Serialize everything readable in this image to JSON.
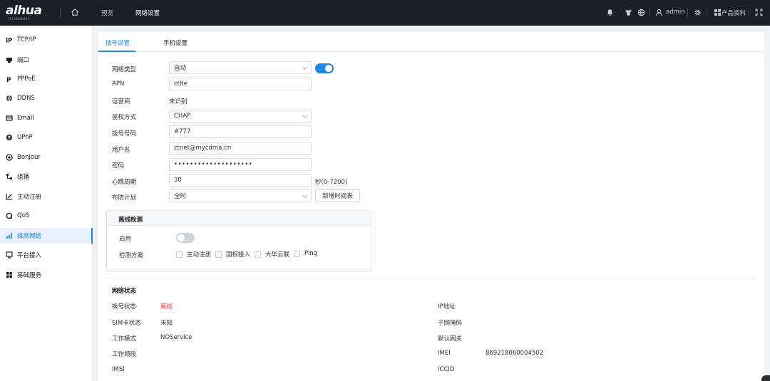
{
  "topbar": {
    "logo": "alhua",
    "logo_sub": "TECHNOLOGY",
    "nav": [
      {
        "label": "预览"
      },
      {
        "label": "网络设置"
      }
    ],
    "user": "admin",
    "docs": "产品资料"
  },
  "sidebar": {
    "items": [
      {
        "label": "TCP/IP",
        "icon": "ip-icon"
      },
      {
        "label": "端口",
        "icon": "port-icon"
      },
      {
        "label": "PPPoE",
        "icon": "pppoe-icon"
      },
      {
        "label": "DDNS",
        "icon": "globe-icon"
      },
      {
        "label": "Email",
        "icon": "mail-icon"
      },
      {
        "label": "UPnP",
        "icon": "upnp-icon"
      },
      {
        "label": "Bonjour",
        "icon": "bonjour-icon"
      },
      {
        "label": "组播",
        "icon": "multicast-icon"
      },
      {
        "label": "主动注册",
        "icon": "register-icon"
      },
      {
        "label": "QoS",
        "icon": "qos-icon"
      },
      {
        "label": "蜂窝网络",
        "icon": "cellular-icon"
      },
      {
        "label": "平台接入",
        "icon": "platform-icon"
      },
      {
        "label": "基础服务",
        "icon": "services-icon"
      }
    ]
  },
  "tabs": [
    {
      "label": "拨号设置"
    },
    {
      "label": "手机设置"
    }
  ],
  "form": {
    "network_type": {
      "label": "网络类型",
      "value": "自动"
    },
    "apn": {
      "label": "APN",
      "value": "ctlte"
    },
    "operator": {
      "label": "运营商",
      "value": "未识别"
    },
    "auth": {
      "label": "鉴权方式",
      "value": "CHAP"
    },
    "dial_number": {
      "label": "拨号号码",
      "value": "#777"
    },
    "username": {
      "label": "用户名",
      "value": "ctnet@mycdma.cn"
    },
    "password": {
      "label": "密码",
      "value": "••••••••••••••••••••"
    },
    "heartbeat": {
      "label": "心跳周期",
      "value": "30",
      "unit": "秒(0-7200)"
    },
    "schedule": {
      "label": "布防计划",
      "value": "全时",
      "button": "新增时间表"
    }
  },
  "offline": {
    "title": "离线检测",
    "enable_label": "启用",
    "method_label": "检测方案",
    "options": [
      {
        "label": "主动注册"
      },
      {
        "label": "国标接入"
      },
      {
        "label": "大华云联"
      },
      {
        "label": "Ping"
      }
    ]
  },
  "status": {
    "title": "网络状态",
    "left": [
      {
        "label": "拨号状态",
        "value": "离线"
      },
      {
        "label": "SIM卡状态",
        "value": "未知"
      },
      {
        "label": "工作模式",
        "value": "NOService"
      },
      {
        "label": "工作频段",
        "value": ""
      },
      {
        "label": "IMSI",
        "value": ""
      }
    ],
    "right": [
      {
        "label": "IP地址",
        "value": ""
      },
      {
        "label": "子网掩码",
        "value": ""
      },
      {
        "label": "默认网关",
        "value": ""
      },
      {
        "label": "IMEI",
        "value": "869218060004502"
      },
      {
        "label": "ICCID",
        "value": ""
      }
    ]
  },
  "colors": {
    "accent": "#1e88e5",
    "topbar": "#1b1e27",
    "offline_status": "#e53935"
  }
}
